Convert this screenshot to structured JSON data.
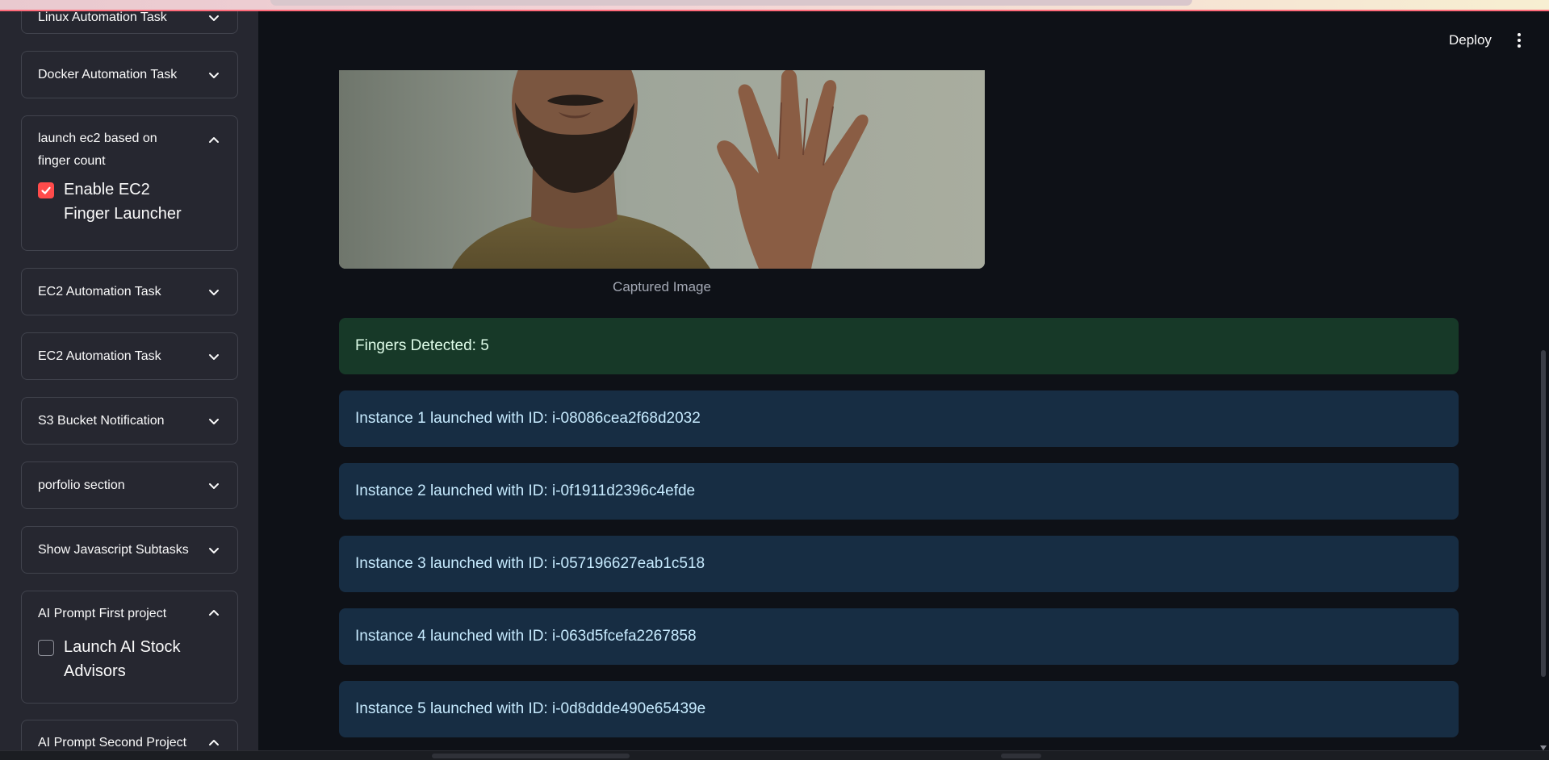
{
  "sidebar": {
    "expanders": [
      {
        "label": "Linux Automation Task",
        "expanded": false
      },
      {
        "label": "Docker Automation Task",
        "expanded": false
      },
      {
        "label": "launch ec2 based on finger count",
        "expanded": true,
        "checkbox": {
          "label": "Enable EC2 Finger Launcher",
          "checked": true
        }
      },
      {
        "label": "EC2 Automation Task",
        "expanded": false
      },
      {
        "label": "EC2 Automation Task",
        "expanded": false
      },
      {
        "label": "S3 Bucket Notification",
        "expanded": false
      },
      {
        "label": "porfolio section",
        "expanded": false
      },
      {
        "label": "Show Javascript Subtasks",
        "expanded": false
      },
      {
        "label": "AI Prompt First project",
        "expanded": true,
        "checkbox": {
          "label": "Launch AI Stock Advisors",
          "checked": false
        }
      },
      {
        "label": "AI Prompt Second Project",
        "expanded": true
      }
    ]
  },
  "header": {
    "deploy_label": "Deploy"
  },
  "main": {
    "image_caption": "Captured Image",
    "success_message": "Fingers Detected: 5",
    "instances": [
      "Instance 1 launched with ID: i-08086cea2f68d2032",
      "Instance 2 launched with ID: i-0f1911d2396c4efde",
      "Instance 3 launched with ID: i-057196627eab1c518",
      "Instance 4 launched with ID: i-063d5fcefa2267858",
      "Instance 5 launched with ID: i-0d8ddde490e65439e"
    ]
  },
  "colors": {
    "background": "#0e1117",
    "sidebar": "#262730",
    "accent": "#ff4b4b",
    "success_bg": "#173928",
    "info_bg": "#172d43"
  }
}
